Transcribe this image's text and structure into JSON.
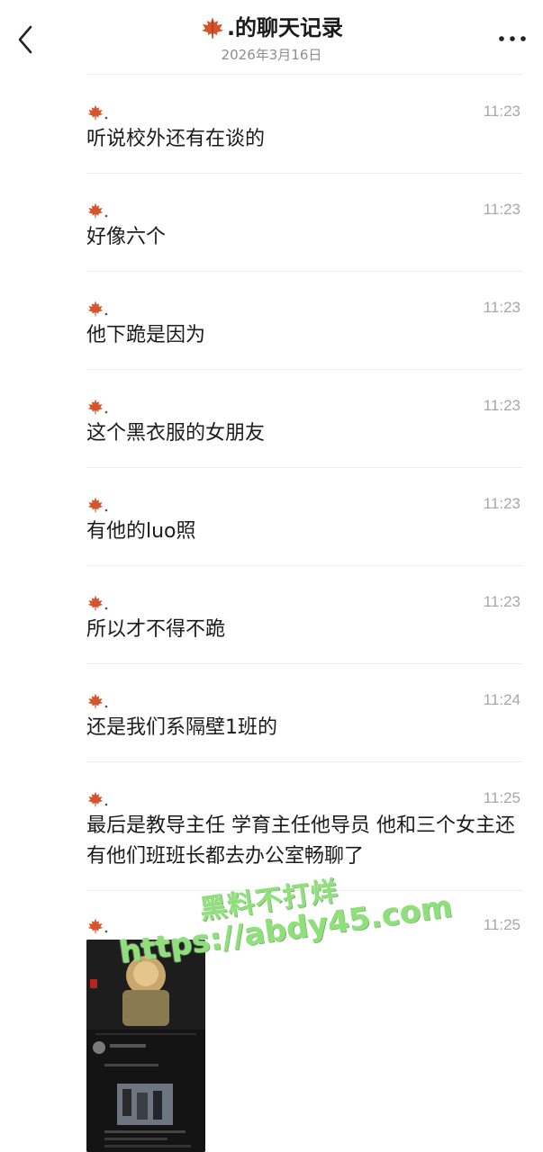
{
  "header": {
    "title": ".的聊天记录",
    "date": "2026年3月16日"
  },
  "messages": [
    {
      "sender_icon": "maple-leaf-icon",
      "time": "11:23",
      "text": "听说校外还有在谈的"
    },
    {
      "sender_icon": "maple-leaf-icon",
      "time": "11:23",
      "text": "好像六个"
    },
    {
      "sender_icon": "maple-leaf-icon",
      "time": "11:23",
      "text": "他下跪是因为"
    },
    {
      "sender_icon": "maple-leaf-icon",
      "time": "11:23",
      "text": "这个黑衣服的女朋友"
    },
    {
      "sender_icon": "maple-leaf-icon",
      "time": "11:23",
      "text": "有他的luo照"
    },
    {
      "sender_icon": "maple-leaf-icon",
      "time": "11:23",
      "text": "所以才不得不跪"
    },
    {
      "sender_icon": "maple-leaf-icon",
      "time": "11:24",
      "text": "还是我们系隔壁1班的"
    },
    {
      "sender_icon": "maple-leaf-icon",
      "time": "11:25",
      "text": "最后是教导主任 学育主任他导员 他和三个女主还有他们班班长都去办公室畅聊了"
    },
    {
      "sender_icon": "maple-leaf-icon",
      "time": "11:25",
      "text": ""
    }
  ],
  "watermark": {
    "line1": "黑料不打烊",
    "line2": "https://abdy45.com"
  },
  "colors": {
    "leaf": "#d4552b",
    "watermark": "#8fe07a",
    "time": "#a7a7a7",
    "divider": "#ececec"
  }
}
